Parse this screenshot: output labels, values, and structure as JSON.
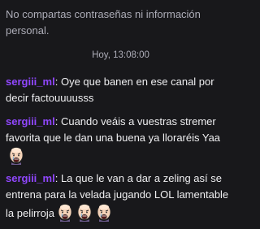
{
  "chat": {
    "notice": "No compartas contraseñas ni información personal.",
    "timestamp": "Hoy, 13:08:00",
    "username_color": "#9147ff",
    "messages": [
      {
        "username": "sergiii_ml",
        "separator": ":",
        "text": "Oye que banen en ese canal por decir factouuuusss",
        "emotes": []
      },
      {
        "username": "sergiii_ml",
        "separator": ":",
        "text": "Cuando veáis a vuestras stremer favorita que le dan una buena ya lloraréis Yaa",
        "emotes": [
          "crying-face-emote"
        ]
      },
      {
        "username": "sergiii_ml",
        "separator": ":",
        "text": "La que le van a dar a zeling así se entrena para la velada jugando LOL lamentable la pelirroja",
        "emotes": [
          "crying-face-emote",
          "crying-face-emote",
          "crying-face-emote"
        ]
      }
    ]
  }
}
